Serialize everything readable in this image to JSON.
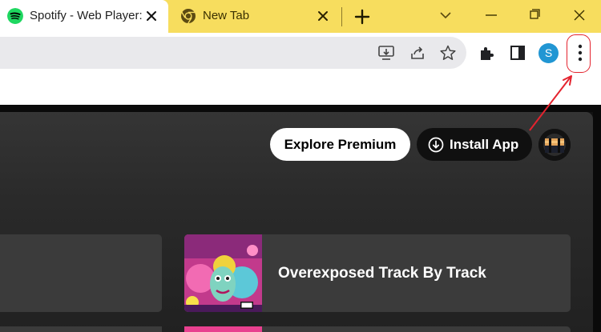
{
  "browser": {
    "tabs": [
      {
        "title": "Spotify - Web Player:",
        "favicon": "spotify-icon",
        "active": true
      },
      {
        "title": "New Tab",
        "favicon": "chrome-icon",
        "active": false
      }
    ],
    "profile_initial": "S",
    "accent": "#f7dd5e",
    "highlight_color": "#e4232e"
  },
  "spotify": {
    "explore_premium_label": "Explore Premium",
    "install_app_label": "Install App",
    "cards": [
      {
        "title": ""
      },
      {
        "title": "Overexposed Track By Track"
      }
    ],
    "brand_color": "#1ed760"
  }
}
